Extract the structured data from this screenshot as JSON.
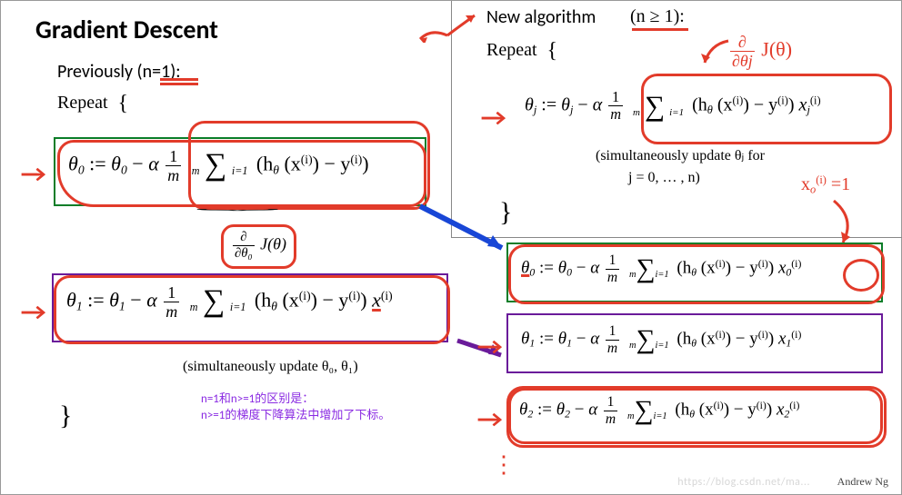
{
  "title": "Gradient Descent",
  "left": {
    "subtitle": "Previously (n=1):",
    "repeat": "Repeat",
    "brace_open": "{",
    "brace_close": "}",
    "eq0": {
      "lhs_param": "θ",
      "lhs_sub": "0",
      "assign": ":=",
      "rhs_param": "θ",
      "rhs_sub": "0",
      "minus": "−",
      "alpha": "α",
      "frac_num": "1",
      "frac_den": "m",
      "sum_top": "m",
      "sum_bot": "i=1",
      "term_open": "(h",
      "term_h_sub": "θ",
      "term_x": "(x",
      "term_x_sup": "(i)",
      "term_close1": ")",
      "term_minus": " − y",
      "term_y_sup": "(i)",
      "term_close2": ")"
    },
    "deriv_label_top": "∂",
    "deriv_label_bot": "∂θ₀",
    "deriv_of": "J(θ)",
    "eq1": {
      "lhs_param": "θ",
      "lhs_sub": "1",
      "assign": ":=",
      "rhs_param": "θ",
      "rhs_sub": "1",
      "minus": "−",
      "alpha": "α",
      "frac_num": "1",
      "frac_den": "m",
      "sum_top": "m",
      "sum_bot": "i=1",
      "term_open": "(h",
      "term_h_sub": "θ",
      "term_x": "(x",
      "term_x_sup": "(i)",
      "term_close1": ")",
      "term_minus": " − y",
      "term_y_sup": "(i)",
      "term_close2": ")",
      "trail_x": "x",
      "trail_x_sup": "(i)"
    },
    "simu": "(simultaneously update θ₀, θ₁)",
    "note_line1": "n=1和n>=1的区别是：",
    "note_line2": "n>=1的梯度下降算法中增加了下标。"
  },
  "right": {
    "subtitle": "New algorithm",
    "condition": "(n ≥ 1):",
    "repeat": "Repeat",
    "brace_open": "{",
    "brace_close": "}",
    "deriv_hand_top": "∂",
    "deriv_hand_bot": "∂θj",
    "deriv_hand_of": "J(θ)",
    "eqj": {
      "lhs_param": "θ",
      "lhs_sub": "j",
      "assign": ":=",
      "rhs_param": "θ",
      "rhs_sub": "j",
      "minus": "−",
      "alpha": "α",
      "frac_num": "1",
      "frac_den": "m",
      "sum_top": "m",
      "sum_bot": "i=1",
      "term_open": "(h",
      "term_h_sub": "θ",
      "term_x": "(x",
      "term_x_sup": "(i)",
      "term_close1": ")",
      "term_minus": " − y",
      "term_y_sup": "(i)",
      "term_close2": ")",
      "trail_x": "x",
      "trail_x_sub": "j",
      "trail_x_sup": "(i)"
    },
    "simu1": "(simultaneously update  θⱼ  for",
    "simu2": "j = 0, … , n)",
    "eq0": {
      "lhs_param": "θ",
      "lhs_sub": "0",
      "trail_x_sub": "0"
    },
    "eq1": {
      "lhs_param": "θ",
      "lhs_sub": "1",
      "trail_x_sub": "1"
    },
    "eq2": {
      "lhs_param": "θ",
      "lhs_sub": "2",
      "trail_x_sub": "2"
    },
    "scribble_xo": "x₀  = 1",
    "scribble_xo_sup": "(i)"
  },
  "footer": {
    "author": "Andrew Ng",
    "watermark": "https://blog.csdn.net/ma..."
  }
}
